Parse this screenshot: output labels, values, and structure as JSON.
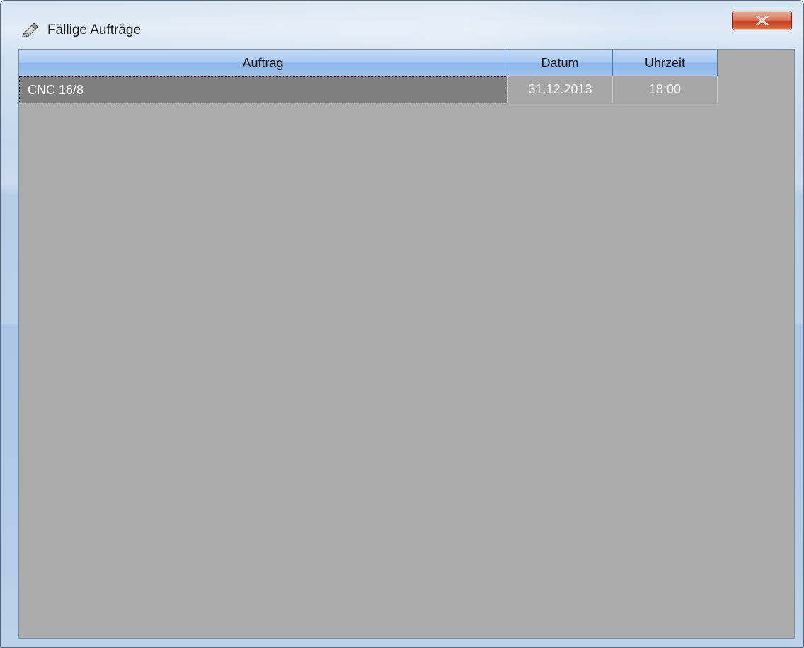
{
  "window": {
    "title": "Fällige Aufträge",
    "title_icon": "pencil-edit-icon",
    "close_icon": "close-icon"
  },
  "grid": {
    "columns": [
      {
        "key": "auftrag",
        "label": "Auftrag"
      },
      {
        "key": "datum",
        "label": "Datum"
      },
      {
        "key": "uhrzeit",
        "label": "Uhrzeit"
      }
    ],
    "rows": [
      {
        "auftrag": "CNC 16/8",
        "datum": "31.12.2013",
        "uhrzeit": "18:00",
        "selected": true
      }
    ]
  },
  "colors": {
    "grid_background": "#ababab",
    "header_blue": "#a9c8f1",
    "selected_row": "#7f7f7f",
    "close_button_red": "#c6421f"
  }
}
